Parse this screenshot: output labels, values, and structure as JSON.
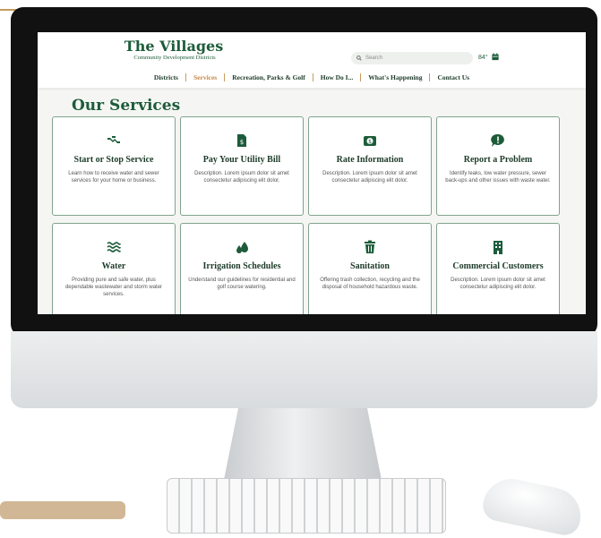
{
  "site": {
    "logo_title": "The Villages",
    "logo_subtitle": "Community Development Districts",
    "search_placeholder": "Search",
    "temperature": "84°"
  },
  "nav": [
    {
      "label": "Districts",
      "active": false
    },
    {
      "label": "Services",
      "active": true
    },
    {
      "label": "Recreation, Parks & Golf",
      "active": false
    },
    {
      "label": "How Do I...",
      "active": false
    },
    {
      "label": "What's Happening",
      "active": false
    },
    {
      "label": "Contact Us",
      "active": false
    }
  ],
  "page_title": "Our Services",
  "cards": [
    {
      "icon": "handshake-icon",
      "title": "Start or Stop Service",
      "desc": "Learn how to receive water and sewer services for your home or business."
    },
    {
      "icon": "bill-icon",
      "title": "Pay Your Utility Bill",
      "desc": "Description. Lorem ipsum dolor sit amet consectetur adipiscing elit dolor."
    },
    {
      "icon": "money-icon",
      "title": "Rate Information",
      "desc": "Description. Lorem ipsum dolor sit amet consectetur adipiscing elit dolor."
    },
    {
      "icon": "alert-bubble-icon",
      "title": "Report a Problem",
      "desc": "Identify leaks, low water pressure, sewer back-ups and other issues with waste water."
    },
    {
      "icon": "water-waves-icon",
      "title": "Water",
      "desc": "Providing pure and safe water, plus dependable wastewater and storm water services."
    },
    {
      "icon": "droplets-icon",
      "title": "Irrigation Schedules",
      "desc": "Understand our guidelines for residential and golf course watering."
    },
    {
      "icon": "trash-can-icon",
      "title": "Sanitation",
      "desc": "Offering trash collection, recycling and the disposal of household hazardous waste."
    },
    {
      "icon": "building-icon",
      "title": "Commercial Customers",
      "desc": "Description. Lorem ipsum dolor sit amet consectetur adipiscing elit dolor."
    }
  ],
  "colors": {
    "brand_green": "#1d5c3a",
    "accent_gold": "#c8874a",
    "card_border": "#7fa48d"
  }
}
